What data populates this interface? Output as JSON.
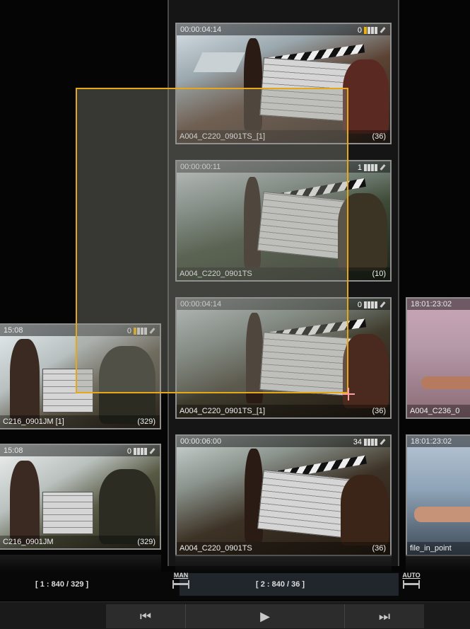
{
  "clips": [
    {
      "id": "c1",
      "timecode": "00:00:04:14",
      "badge_count": "0",
      "name": "A004_C220_0901TS_[1]",
      "count": "(36)"
    },
    {
      "id": "c2",
      "timecode": "00:00:00:11",
      "badge_count": "1",
      "name": "A004_C220_0901TS",
      "count": "(10)"
    },
    {
      "id": "c3",
      "timecode": "00:00:04:14",
      "badge_count": "0",
      "name": "A004_C220_0901TS_[1]",
      "count": "(36)"
    },
    {
      "id": "c4",
      "timecode": "00:00:06:00",
      "badge_count": "34",
      "name": "A004_C220_0901TS",
      "count": "(36)"
    },
    {
      "id": "l1",
      "timecode": "15:08",
      "badge_count": "0",
      "name": "C216_0901JM [1]",
      "count": "(329)"
    },
    {
      "id": "l2",
      "timecode": "15:08",
      "badge_count": "0",
      "name": "C216_0901JM",
      "count": "(329)"
    },
    {
      "id": "r1",
      "timecode": "18:01:23:02",
      "badge_count": "",
      "name": "A004_C236_0",
      "count": ""
    },
    {
      "id": "r2",
      "timecode": "18:01:23:02",
      "badge_count": "",
      "name": "file_in_point",
      "count": ""
    }
  ],
  "status": {
    "left": "[ 1 : 840 / 329 ]",
    "middle": "[ 2 : 840 / 36 ]",
    "manual_label": "MAN",
    "auto_label": "AUTO"
  },
  "transport": {
    "prev": "⏮",
    "play": "▶",
    "next": "⏭"
  },
  "colors": {
    "selection": "#e6a817",
    "rating_on": "#f2b200"
  }
}
